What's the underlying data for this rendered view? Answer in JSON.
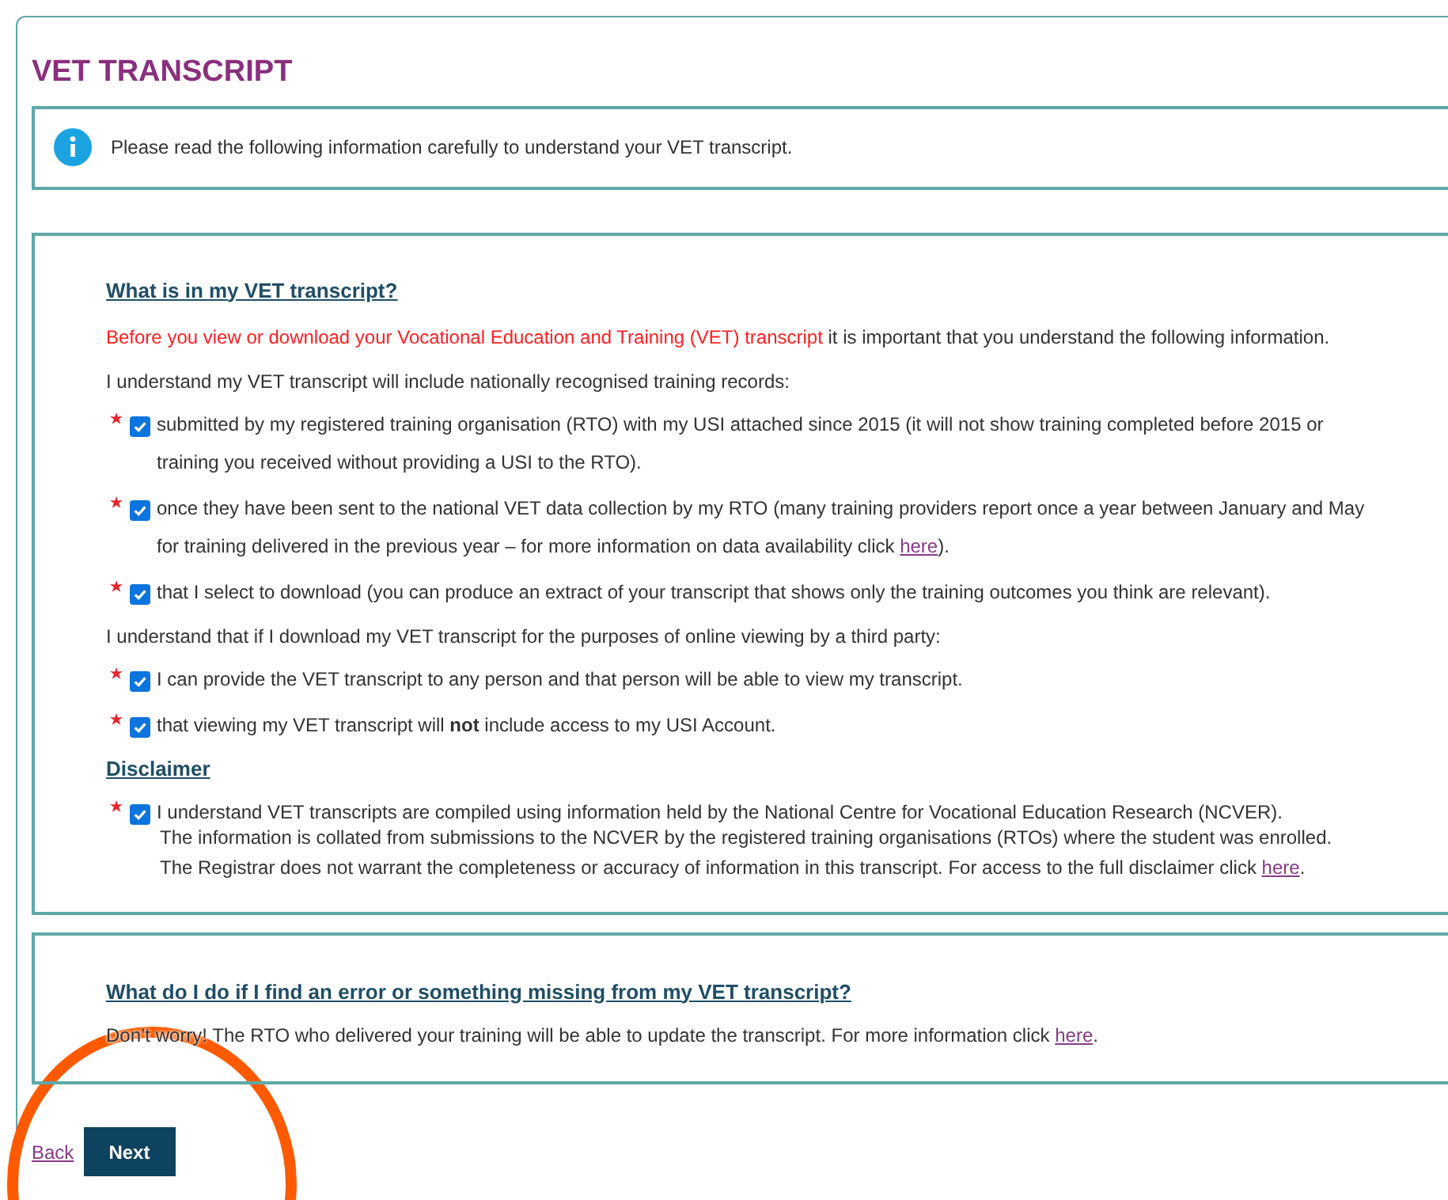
{
  "title": "VET TRANSCRIPT",
  "info": {
    "text": "Please read the following information carefully to understand your VET transcript."
  },
  "section": {
    "heading": "What is in my VET transcript?",
    "intro_highlight": "Before you view or download your Vocational Education and Training (VET) transcript",
    "intro_rest": " it is important that you understand the following information.",
    "groups": [
      {
        "lead": "I understand my VET transcript will include nationally recognised training records:",
        "items": [
          {
            "text": "submitted by my registered training organisation (RTO) with my USI attached since 2015 (it will not show training completed before 2015 or training you received without providing a USI to the RTO).",
            "checked": true
          },
          {
            "text": "once they have been sent to the national VET data collection by my RTO (many training providers report once a year between January and May for training delivered in the previous year – for more information on data availability click ",
            "link": "here",
            "after": ").",
            "checked": true
          },
          {
            "text": "that I select to download (you can produce an extract of your transcript that shows only the training outcomes you think are relevant).",
            "checked": true
          }
        ]
      },
      {
        "lead": "I understand that if I download my VET transcript for the purposes of online viewing by a third party:",
        "items": [
          {
            "text": "I can provide the VET transcript to any person and that person will be able to view my transcript.",
            "checked": true
          },
          {
            "text": "that viewing my VET transcript will **not** include access to my USI Account.",
            "checked": true
          }
        ]
      }
    ],
    "disclaimer": {
      "heading": "Disclaimer",
      "item": {
        "text": "I understand VET transcripts are compiled using information held by the National Centre for Vocational Education Research (NCVER).",
        "checked": true
      },
      "lines": [
        {
          "text": "The information is collated from submissions to the NCVER by the registered training organisations (RTOs) where the student was enrolled."
        },
        {
          "text": "The Registrar does not warrant the completeness or accuracy of information in this transcript. For access to the full disclaimer click ",
          "link": "here",
          "after": "."
        }
      ]
    }
  },
  "help": {
    "heading": "What do I do if I find an error or something missing from my VET transcript?",
    "text": "Don’t worry! The RTO who delivered your training will be able to update the transcript. For more information click ",
    "link": "here",
    "after": "."
  },
  "actions": {
    "back": "Back",
    "next": "Next"
  }
}
